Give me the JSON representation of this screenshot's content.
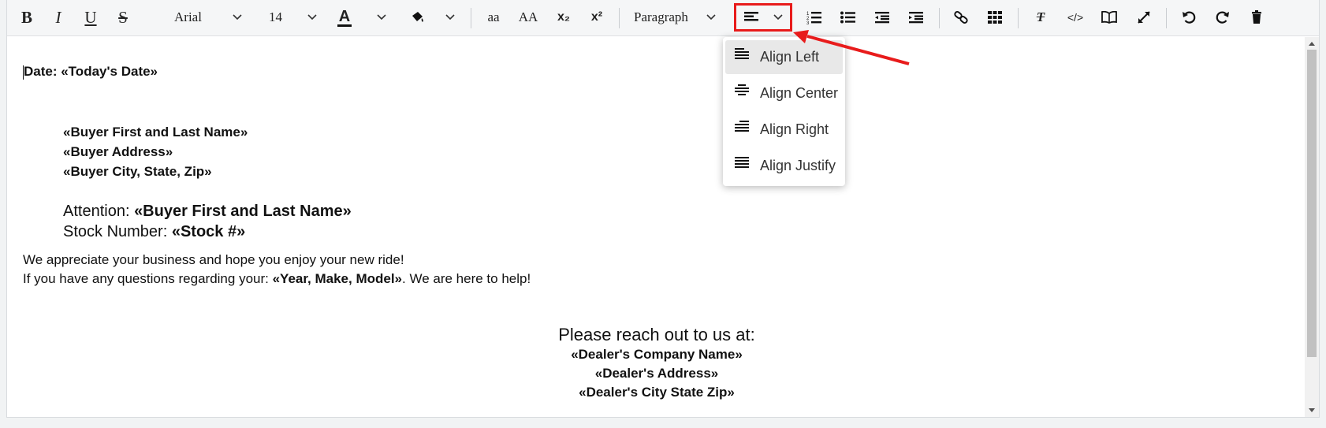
{
  "toolbar": {
    "bold": "B",
    "italic": "I",
    "underline": "U",
    "strike": "S",
    "font_family": "Arial",
    "font_size": "14",
    "font_color_glyph": "A",
    "lowercase": "aa",
    "uppercase": "AA",
    "subscript": "x₂",
    "superscript": "x²",
    "block_format": "Paragraph",
    "clear_format_glyph": "T",
    "code_glyph": "</>"
  },
  "align_dropdown": {
    "items": [
      {
        "label": "Align Left",
        "icon": "align-left-icon",
        "active": true
      },
      {
        "label": "Align Center",
        "icon": "align-center-icon",
        "active": false
      },
      {
        "label": "Align Right",
        "icon": "align-right-icon",
        "active": false
      },
      {
        "label": "Align Justify",
        "icon": "align-justify-icon",
        "active": false
      }
    ]
  },
  "document": {
    "date_line": "Date: «Today's Date»",
    "buyer_name": "«Buyer First and Last Name»",
    "buyer_address": "«Buyer Address»",
    "buyer_city": "«Buyer City, State, Zip»",
    "attention_label": "Attention: ",
    "attention_value": "«Buyer First and Last Name»",
    "stock_label": "Stock Number: ",
    "stock_value": "«Stock #»",
    "appreciate_line": "We appreciate your business and hope you enjoy your new ride!",
    "questions_prefix": "If you have any questions regarding your: ",
    "questions_value": "«Year, Make, Model»",
    "questions_suffix": ". We are here to help!",
    "reach_out": "Please reach out to us at:",
    "dealer_company": "«Dealer's Company Name»",
    "dealer_address": "«Dealer's Address»",
    "dealer_city": "«Dealer's City State Zip»"
  },
  "colors": {
    "highlight_box": "#e81b1b",
    "annotation_arrow": "#e81b1b",
    "dropdown_active_bg": "#e8e8e8"
  }
}
